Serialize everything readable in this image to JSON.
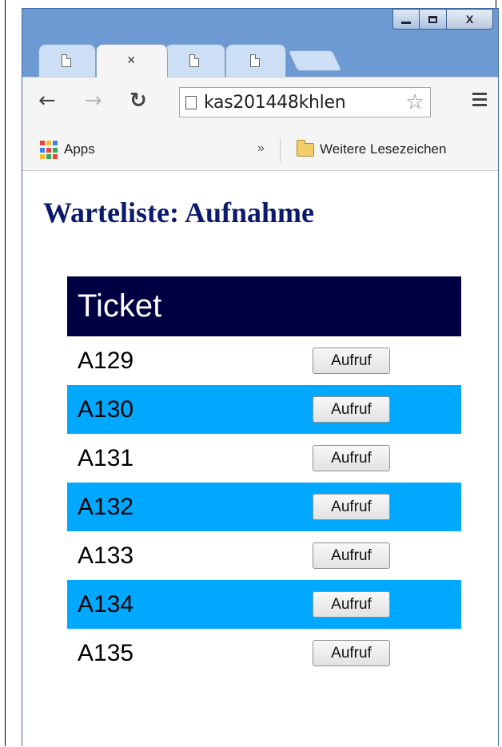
{
  "browser": {
    "url": "kas201448khlen",
    "window_controls": {
      "close_label": "X"
    },
    "tabs": [
      {
        "active": false
      },
      {
        "active": true,
        "close_label": "×"
      },
      {
        "active": false
      },
      {
        "active": false
      }
    ]
  },
  "toolbar": {
    "back_icon": "back-arrow-icon",
    "forward_icon": "forward-arrow-icon",
    "reload_icon": "reload-icon",
    "star_icon": "star-icon",
    "menu_icon": "menu-icon"
  },
  "bookmarks": {
    "apps_label": "Apps",
    "overflow_label": "»",
    "folder_label": "Weitere Lesezeichen"
  },
  "page": {
    "title": "Warteliste: Aufnahme",
    "table": {
      "header": "Ticket",
      "button_label": "Aufruf",
      "rows": [
        {
          "ticket": "A129",
          "highlighted": false
        },
        {
          "ticket": "A130",
          "highlighted": true
        },
        {
          "ticket": "A131",
          "highlighted": false
        },
        {
          "ticket": "A132",
          "highlighted": true
        },
        {
          "ticket": "A133",
          "highlighted": false
        },
        {
          "ticket": "A134",
          "highlighted": true
        },
        {
          "ticket": "A135",
          "highlighted": false
        }
      ]
    }
  },
  "colors": {
    "title": "#0c1a6e",
    "table_header_bg": "#010042",
    "row_highlight": "#00a9ff",
    "frame": "#6e9ad4"
  }
}
